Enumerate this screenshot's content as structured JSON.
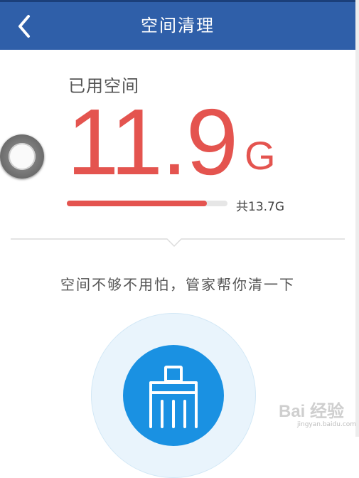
{
  "header": {
    "title": "空间清理",
    "back_icon": "chevron-left-icon"
  },
  "storage": {
    "used_label": "已用空间",
    "used_value": "11.9",
    "used_unit": "G",
    "total_label": "共13.7G",
    "used_fraction": 0.87
  },
  "hint": "空间不够不用怕，管家帮你清一下",
  "clean_button": {
    "icon": "broom-icon"
  },
  "colors": {
    "header": "#2f5fa9",
    "accent_red": "#e4544f",
    "accent_blue": "#1a91e2"
  },
  "watermark": {
    "text": "Bai 经验",
    "sub": "jingyan.baidu.com"
  }
}
